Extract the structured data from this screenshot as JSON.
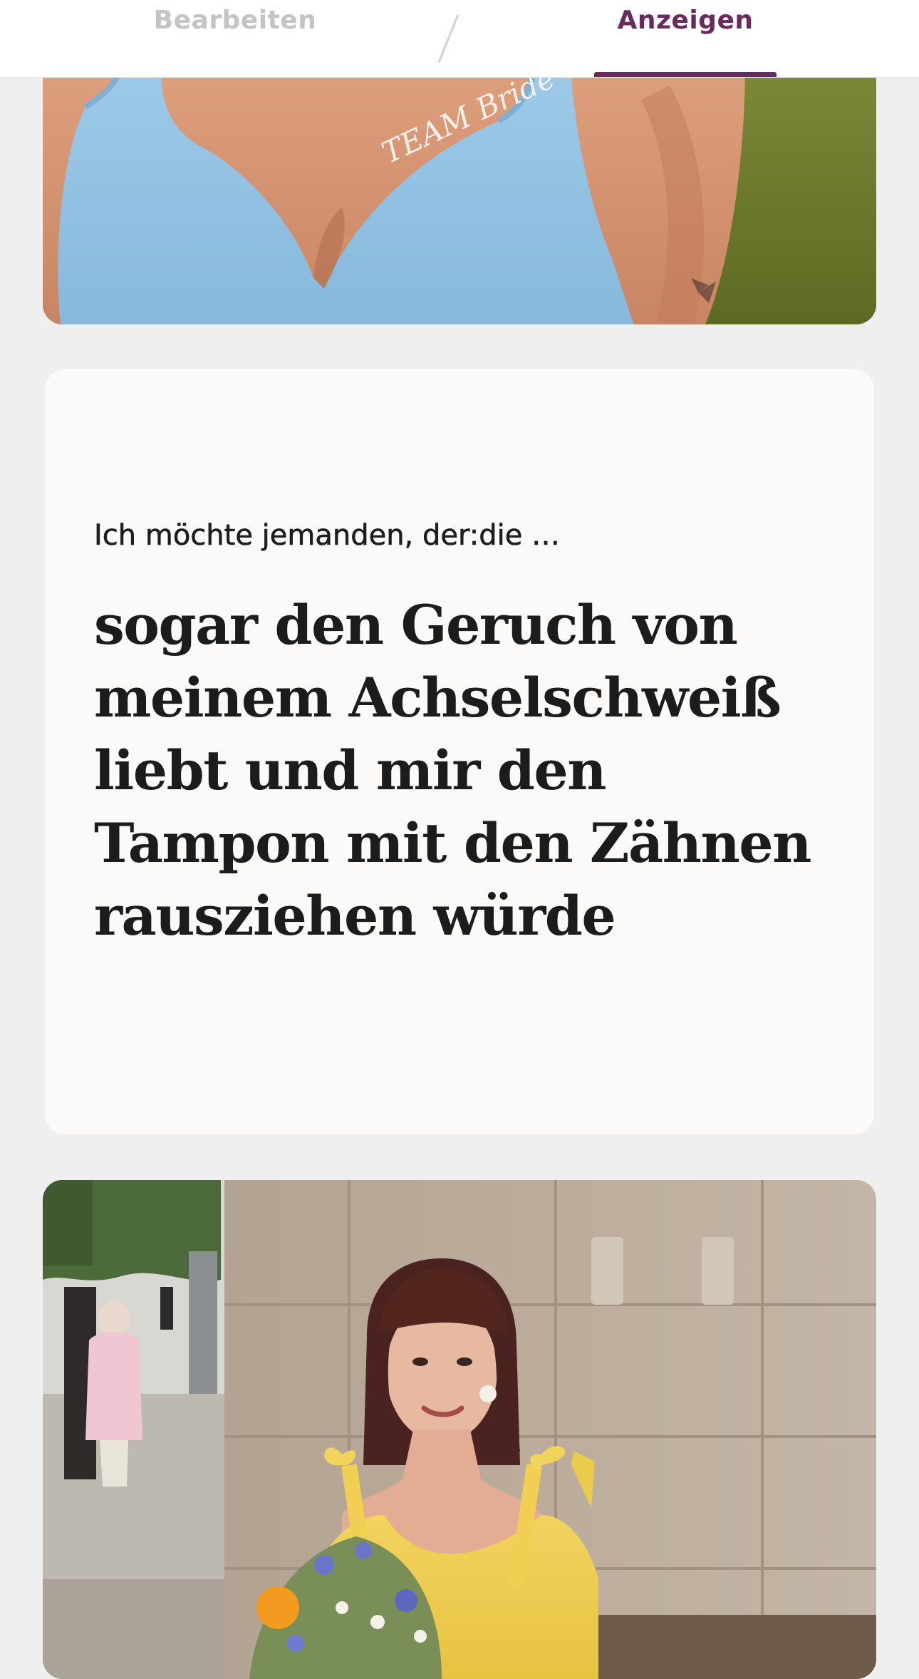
{
  "tabs": {
    "edit_label": "Bearbeiten",
    "show_label": "Anzeigen",
    "active": "Anzeigen"
  },
  "prompt": {
    "question": "Ich möchte jemanden, der:die …",
    "answer": "sogar den Geruch von meinem Achselschweiß liebt und mir den Tampon mit den Zähnen rausziehen würde"
  },
  "photos": [
    {
      "id": "photo-1",
      "tattoo_text": "TEAM Bride"
    },
    {
      "id": "photo-2"
    }
  ],
  "colors": {
    "accent": "#6b2a5e",
    "inactive_tab": "#c4c4c4",
    "page_background": "#efefef",
    "card_background": "#fbfaf9"
  }
}
